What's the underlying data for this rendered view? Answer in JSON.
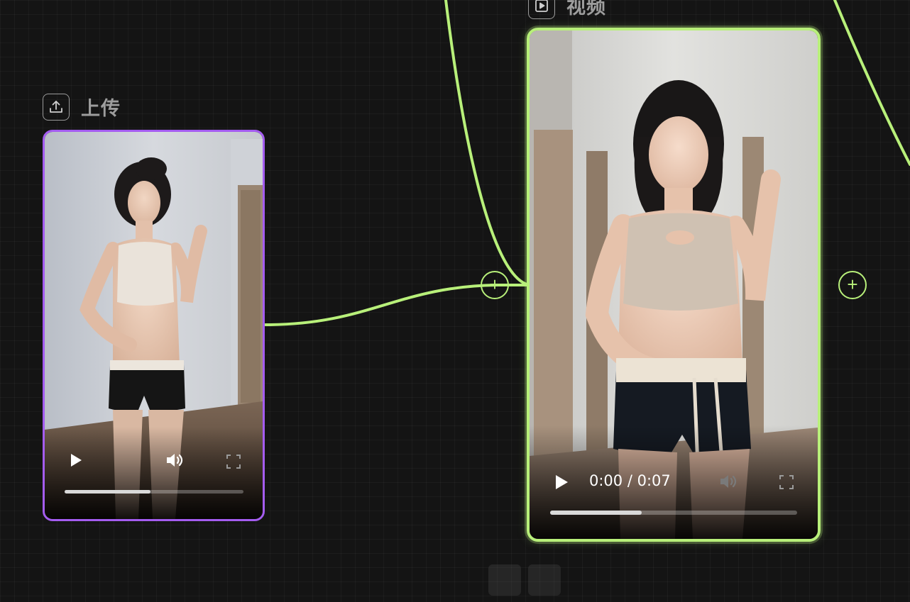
{
  "nodes": {
    "upload": {
      "title": "上传",
      "icon": "upload-icon",
      "player": {
        "progress": 0.48
      }
    },
    "video": {
      "title": "视频",
      "icon": "play-box-icon",
      "player": {
        "time": "0:00 / 0:07",
        "progress": 0.37
      }
    }
  },
  "colors": {
    "upload_border": "#a45cf0",
    "video_border": "#b8f07a",
    "edge": "#b8f07a",
    "canvas_bg": "#141414"
  }
}
